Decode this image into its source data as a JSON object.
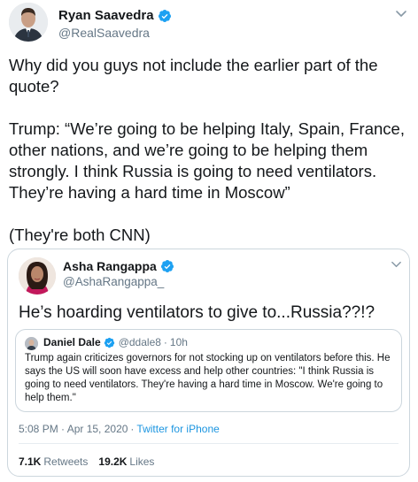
{
  "tweet": {
    "author_name": "Ryan Saavedra",
    "author_handle": "@RealSaavedra",
    "text": "Why did you guys not include the earlier part of the quote?\n\nTrump: “We’re going to be helping Italy, Spain, France, other nations, and we’re going to be helping them strongly. I think Russia is going to need ventilators. They’re having a hard time in Moscow”\n\n(They're both CNN)"
  },
  "quoted": {
    "author_name": "Asha Rangappa",
    "author_handle": "@AshaRangappa_",
    "text": "He’s hoarding ventilators to give to...Russia??!?",
    "nested": {
      "author_name": "Daniel Dale",
      "author_handle": "@ddale8",
      "separator": "·",
      "time": "10h",
      "text": "Trump again criticizes governors for not stocking up on ventilators before this. He says the US will soon have excess and help other countries: \"I think Russia is going to need ventilators. They're having a hard time in Moscow. We're going to help them.\""
    },
    "timestamp": "5:08 PM · Apr 15, 2020",
    "separator": "·",
    "source": "Twitter for iPhone",
    "retweets_count": "7.1K",
    "retweets_label": "Retweets",
    "likes_count": "19.2K",
    "likes_label": "Likes"
  },
  "colors": {
    "verified": "#1da1f2",
    "link": "#1b95e0",
    "secondary_text": "#657786",
    "border": "#ccd6dd"
  },
  "icons": {
    "verified": "verified-badge-icon",
    "caret": "chevron-down-icon"
  }
}
